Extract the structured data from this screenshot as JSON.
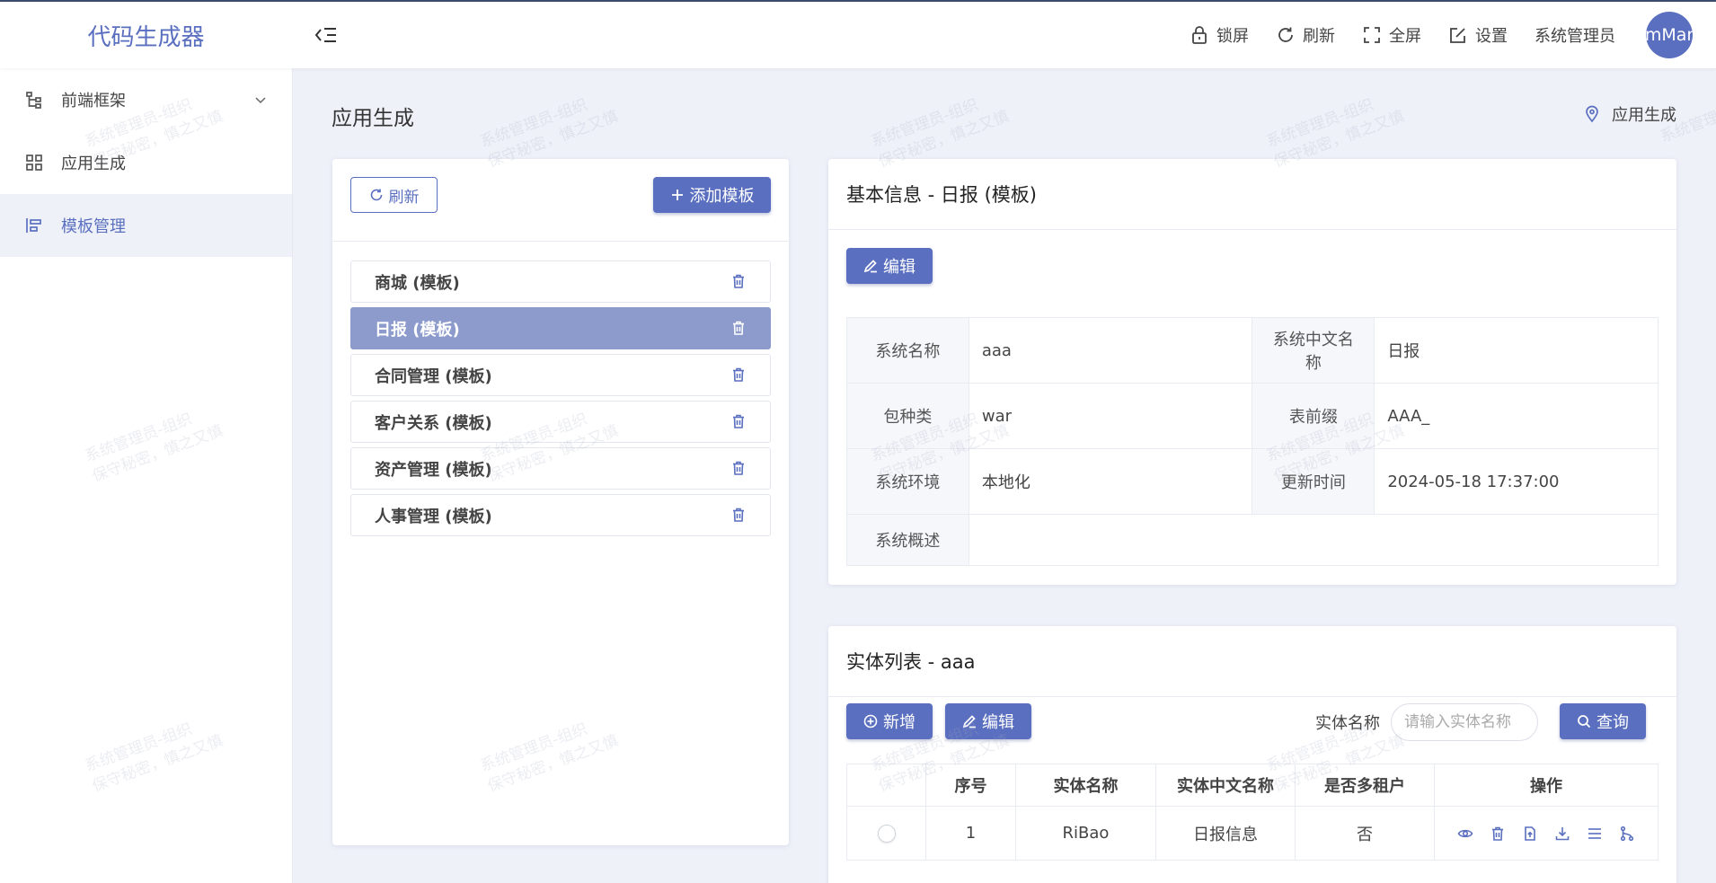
{
  "app": {
    "title": "代码生成器"
  },
  "header": {
    "lock": "锁屏",
    "refresh": "刷新",
    "fullscreen": "全屏",
    "settings": "设置",
    "user": "系统管理员",
    "avatar_text": "mMar"
  },
  "sidebar": {
    "items": [
      {
        "label": "前端框架",
        "icon": "tree-icon",
        "has_children": true
      },
      {
        "label": "应用生成",
        "icon": "grid-icon"
      },
      {
        "label": "模板管理",
        "icon": "align-icon",
        "active": true
      }
    ]
  },
  "page": {
    "title": "应用生成",
    "breadcrumb": "应用生成"
  },
  "template_panel": {
    "refresh_label": "刷新",
    "add_label": "添加模板",
    "items": [
      {
        "label": "商城 (模板)"
      },
      {
        "label": "日报 (模板)",
        "active": true
      },
      {
        "label": "合同管理 (模板)"
      },
      {
        "label": "客户关系 (模板)"
      },
      {
        "label": "资产管理 (模板)"
      },
      {
        "label": "人事管理 (模板)"
      }
    ]
  },
  "info": {
    "title": "基本信息 - 日报 (模板)",
    "edit_label": "编辑",
    "rows": [
      {
        "l1": "系统名称",
        "v1": "aaa",
        "l2": "系统中文名称",
        "v2": "日报"
      },
      {
        "l1": "包种类",
        "v1": "war",
        "l2": "表前缀",
        "v2": "AAA_"
      },
      {
        "l1": "系统环境",
        "v1": "本地化",
        "l2": "更新时间",
        "v2": "2024-05-18 17:37:00"
      }
    ],
    "desc_label": "系统概述",
    "desc_value": ""
  },
  "entity": {
    "title": "实体列表 - aaa",
    "add_label": "新增",
    "edit_label": "编辑",
    "search_label": "实体名称",
    "search_placeholder": "请输入实体名称",
    "query_label": "查询",
    "columns": [
      "",
      "序号",
      "实体名称",
      "实体中文名称",
      "是否多租户",
      "操作"
    ],
    "rows": [
      {
        "index": "1",
        "name": "RiBao",
        "cn_name": "日报信息",
        "multi_tenant": "否"
      }
    ]
  },
  "watermark": {
    "line1": "系统管理员-组织",
    "line2": "保守秘密，慎之又慎"
  },
  "colors": {
    "primary": "#5a6fbf",
    "active_item": "#8c9bcc",
    "background": "#eef1f8"
  }
}
